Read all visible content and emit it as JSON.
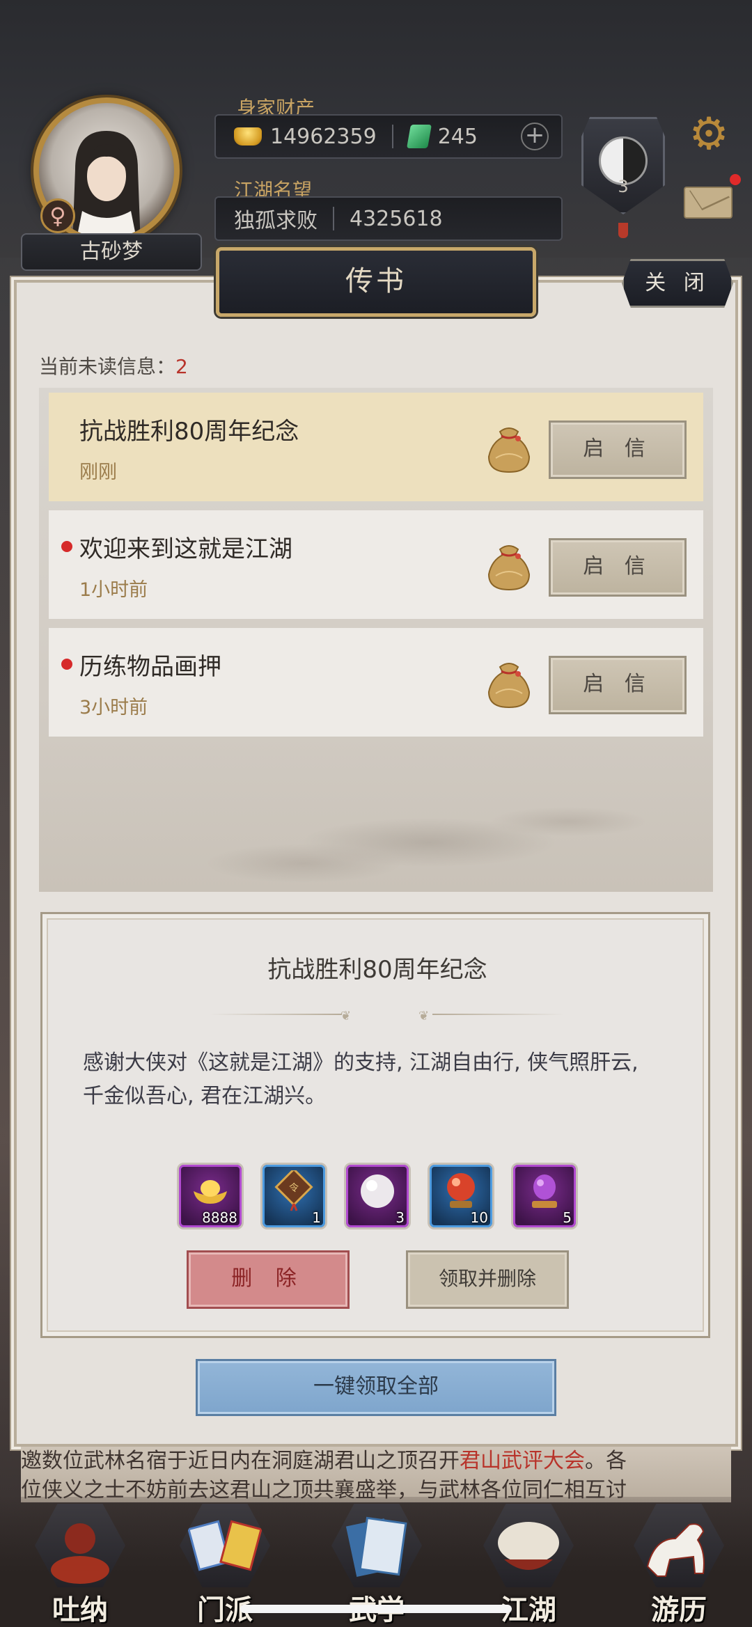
{
  "header": {
    "player_name": "古砂梦",
    "gender_symbol": "♀",
    "wealth_label": "身家财产",
    "gold": "14962359",
    "jade": "245",
    "plus": "+",
    "fame_label": "江湖名望",
    "fame_title": "独孤求败",
    "fame_value": "4325618",
    "level": "3"
  },
  "panel": {
    "title": "传书",
    "close_label": "关 闭",
    "unread_label": "当前未读信息：",
    "unread_count": "2"
  },
  "messages": [
    {
      "title": "抗战胜利80周年纪念",
      "time": "刚刚",
      "button": "启 信",
      "unread": false,
      "selected": true
    },
    {
      "title": "欢迎来到这就是江湖",
      "time": "1小时前",
      "button": "启 信",
      "unread": true,
      "selected": false
    },
    {
      "title": "历练物品画押",
      "time": "3小时前",
      "button": "启 信",
      "unread": true,
      "selected": false
    }
  ],
  "detail": {
    "title": "抗战胜利80周年纪念",
    "body_line1": "感谢大侠对《这就是江湖》的支持, 江湖自由行, 侠气照肝云,",
    "body_line2": "千金似吾心, 君在江湖兴。",
    "rewards": [
      {
        "icon": "gold-ingot-icon",
        "count": "8888",
        "rarity": "purple"
      },
      {
        "icon": "token-plaque-icon",
        "count": "1",
        "rarity": "blue"
      },
      {
        "icon": "pearl-icon",
        "count": "3",
        "rarity": "purple"
      },
      {
        "icon": "red-orb-icon",
        "count": "10",
        "rarity": "blue"
      },
      {
        "icon": "purple-gem-icon",
        "count": "5",
        "rarity": "purple"
      }
    ],
    "delete_label": "删 除",
    "claim_delete_label": "领取并删除"
  },
  "claim_all_label": "一键领取全部",
  "news": {
    "line1_a": "邀数位武林名宿于近日内在洞庭湖君山之顶召开",
    "line1_highlight": "君山武评大会",
    "line1_b": "。各",
    "line2": "位侠义之士不妨前去这君山之顶共襄盛举，与武林各位同仁相互讨"
  },
  "nav": [
    {
      "label": "吐纳",
      "icon": "meditation-icon"
    },
    {
      "label": "门派",
      "icon": "sect-banner-icon"
    },
    {
      "label": "武学",
      "icon": "martial-book-icon"
    },
    {
      "label": "江湖",
      "icon": "straw-hat-icon"
    },
    {
      "label": "游历",
      "icon": "horse-icon"
    }
  ],
  "colors": {
    "accent_gold": "#c8a86a",
    "unread_red": "#d62a2a",
    "time_brown": "#9b7c4b",
    "claim_all_blue": "#7ea5cc",
    "delete_red": "#d38a8b"
  }
}
